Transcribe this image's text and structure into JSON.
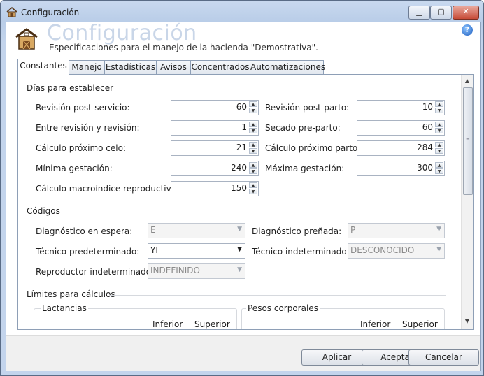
{
  "window": {
    "title": "Configuración"
  },
  "header": {
    "title": "Configuración",
    "subtitle": "Especificaciones para el manejo de la hacienda \"Demostrativa\".",
    "help": "?"
  },
  "tabs": [
    {
      "label": "Constantes",
      "active": true
    },
    {
      "label": "Manejo"
    },
    {
      "label": "Estadísticas"
    },
    {
      "label": "Avisos"
    },
    {
      "label": "Concentrados"
    },
    {
      "label": "Automatizaciones"
    }
  ],
  "days": {
    "title": "Días para establecer",
    "fields": [
      {
        "label": "Revisión post-servicio:",
        "value": "60"
      },
      {
        "label": "Revisión post-parto:",
        "value": "10"
      },
      {
        "label": "Entre revisión y revisión:",
        "value": "1"
      },
      {
        "label": "Secado pre-parto:",
        "value": "60"
      },
      {
        "label": "Cálculo próximo celo:",
        "value": "21"
      },
      {
        "label": "Cálculo próximo parto:",
        "value": "284"
      },
      {
        "label": "Mínima gestación:",
        "value": "240"
      },
      {
        "label": "Máxima gestación:",
        "value": "300"
      },
      {
        "label": "Cálculo macroíndice reproductivo:",
        "value": "150"
      }
    ]
  },
  "codes": {
    "title": "Códigos",
    "fields": [
      {
        "label": "Diagnóstico en espera:",
        "value": "E"
      },
      {
        "label": "Diagnóstico preñada:",
        "value": "P"
      },
      {
        "label": "Técnico predeterminado:",
        "value": "YI"
      },
      {
        "label": "Técnico indeterminado:",
        "value": "DESCONOCIDO"
      },
      {
        "label": "Reproductor indeterminado:",
        "value": "INDEFINIDO"
      }
    ]
  },
  "limits": {
    "title": "Límites para cálculos",
    "lactancias": {
      "title": "Lactancias",
      "col_inferior": "Inferior",
      "col_superior": "Superior"
    },
    "pesos": {
      "title": "Pesos corporales",
      "col_inferior": "Inferior",
      "col_superior": "Superior"
    }
  },
  "buttons": {
    "apply": "Aplicar",
    "accept": "Aceptar",
    "cancel": "Cancelar"
  }
}
